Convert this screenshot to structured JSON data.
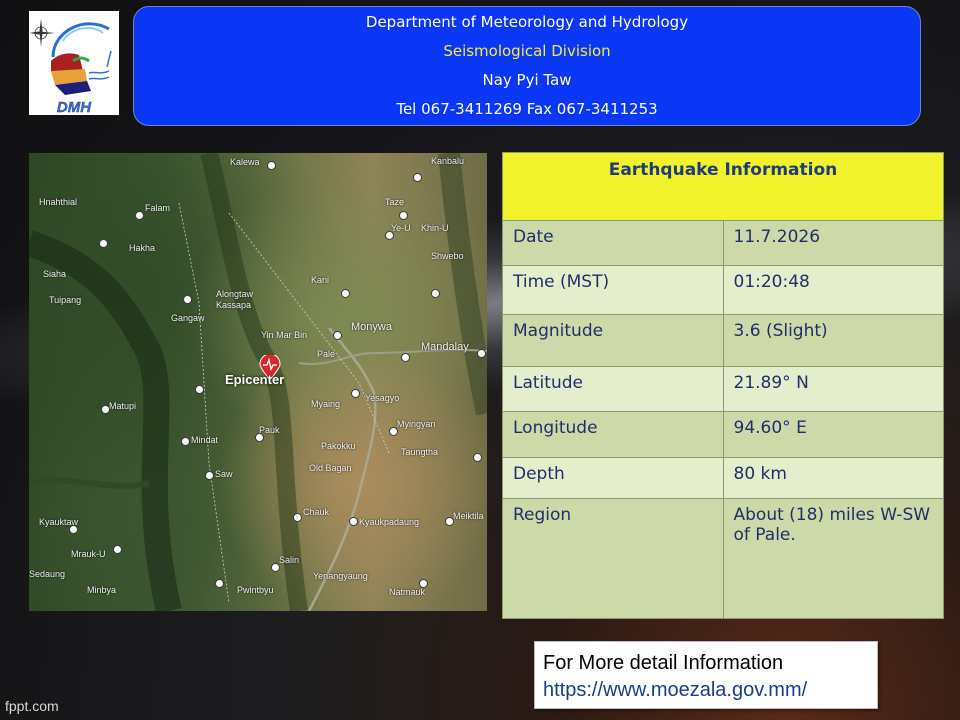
{
  "header": {
    "line1": "Department of Meteorology and Hydrology",
    "line2": "Seismological Division",
    "line3": "Nay Pyi Taw",
    "line4": "Tel 067-3411269 Fax 067-3411253"
  },
  "logo": {
    "text": "DMH",
    "icon": "dmh-logo"
  },
  "map": {
    "epicenter_label": "Epicenter",
    "towns": [
      "Kalewa",
      "Kanbalu",
      "Hnahthial",
      "Falam",
      "Taze",
      "Hakha",
      "Ye-U",
      "Khin-U",
      "Shwebo",
      "Siaha",
      "Kani",
      "Tuipang",
      "Alongtaw Kassapa",
      "Gangaw",
      "Yin Mar Bin",
      "Monywa",
      "Mandalay",
      "Pale",
      "Matupi",
      "Myaing",
      "Yesagyo",
      "Pauk",
      "Myingyan",
      "Mindat",
      "Pakokku",
      "Taungtha",
      "Saw",
      "Old Bagan",
      "Kyauktaw",
      "Chauk",
      "Kyaukpadaung",
      "Meiktila",
      "Mrauk-U",
      "Salin",
      "Yenangyaung",
      "Natmauk",
      "Minbya",
      "Pwintbyu",
      "Sedaung"
    ]
  },
  "info": {
    "title": "Earthquake Information",
    "rows": [
      {
        "label": "Date",
        "value": "11.7.2026"
      },
      {
        "label": "Time (MST)",
        "value": "01:20:48"
      },
      {
        "label": "Magnitude",
        "value": "3.6 (Slight)"
      },
      {
        "label": "Latitude",
        "value": "21.89° N"
      },
      {
        "label": "Longitude",
        "value": "94.60° E"
      },
      {
        "label": "Depth",
        "value": "80 km"
      },
      {
        "label": "Region",
        "value": "About (18) miles W-SW of Pale."
      }
    ]
  },
  "more": {
    "line1": "For More detail Information",
    "url": "https://www.moezala.gov.mm/"
  },
  "watermark": "fppt.com",
  "colors": {
    "header_bg": "#0a36f5",
    "header_accent": "#f5e94a",
    "table_title_bg": "#f2f22a",
    "table_row": "#cdd9a8",
    "table_row_alt": "#e5eecc",
    "epicenter_marker": "#d8262a"
  }
}
